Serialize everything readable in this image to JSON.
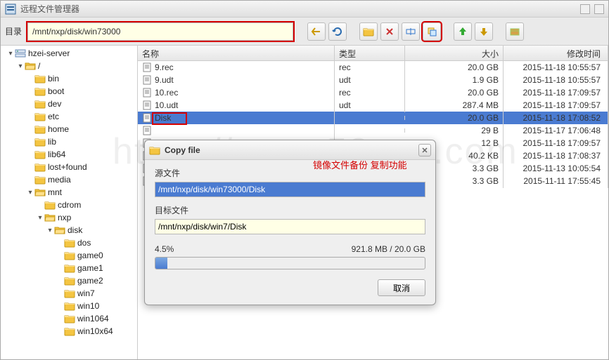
{
  "window": {
    "title": "远程文件管理器"
  },
  "toolbar": {
    "dir_label": "目录",
    "path": "/mnt/nxp/disk/win73000"
  },
  "tree": {
    "root": "hzei-server",
    "rootSlash": "/",
    "items": [
      "bin",
      "boot",
      "dev",
      "etc",
      "home",
      "lib",
      "lib64",
      "lost+found",
      "media"
    ],
    "mnt": "mnt",
    "cdrom": "cdrom",
    "nxp": "nxp",
    "disk": "disk",
    "diskChildren": [
      "dos",
      "game0",
      "game1",
      "game2",
      "win7",
      "win10",
      "win1064",
      "win10x64"
    ]
  },
  "columns": {
    "name": "名称",
    "type": "类型",
    "size": "大小",
    "date": "修改时间"
  },
  "files": [
    {
      "name": "9.rec",
      "type": "rec",
      "size": "20.0 GB",
      "date": "2015-11-18 10:55:57"
    },
    {
      "name": "9.udt",
      "type": "udt",
      "size": "1.9 GB",
      "date": "2015-11-18 10:55:57"
    },
    {
      "name": "10.rec",
      "type": "rec",
      "size": "20.0 GB",
      "date": "2015-11-18 17:09:57"
    },
    {
      "name": "10.udt",
      "type": "udt",
      "size": "287.4 MB",
      "date": "2015-11-18 17:09:57"
    },
    {
      "name": "Disk",
      "type": "",
      "size": "20.0 GB",
      "date": "2015-11-18 17:08:52",
      "selected": true
    },
    {
      "name": "",
      "type": "",
      "size": "29 B",
      "date": "2015-11-17 17:06:48"
    },
    {
      "name": "",
      "type": "",
      "size": "12 B",
      "date": "2015-11-18 17:09:57"
    },
    {
      "name": "",
      "type": "",
      "size": "40.2 KB",
      "date": "2015-11-18 17:08:37"
    },
    {
      "name": "",
      "type": "",
      "size": "3.3 GB",
      "date": "2015-11-13 10:05:54"
    },
    {
      "name": "",
      "type": "",
      "size": "3.3 GB",
      "date": "2015-11-11 17:55:45"
    }
  ],
  "dialog": {
    "title": "Copy file",
    "src_label": "源文件",
    "src_value": "/mnt/nxp/disk/win73000/Disk",
    "dst_label": "目标文件",
    "dst_value": "/mnt/nxp/disk/win7/Disk",
    "percent": "4.5%",
    "progress_value": 4.5,
    "progress_text": "921.8 MB / 20.0 GB",
    "cancel": "取消"
  },
  "annotation": "镜像文件备份 复制功能",
  "watermark": "https://www.58pxe.com",
  "icons": {
    "back": "back-icon",
    "refresh": "refresh-icon",
    "newfolder": "newfolder-icon",
    "delete": "delete-icon",
    "rename": "rename-icon",
    "copy": "copy-icon",
    "upload": "upload-icon",
    "download": "download-icon",
    "archive": "archive-icon"
  },
  "colors": {
    "accent": "#4a7bd1",
    "highlight": "#d40000"
  }
}
